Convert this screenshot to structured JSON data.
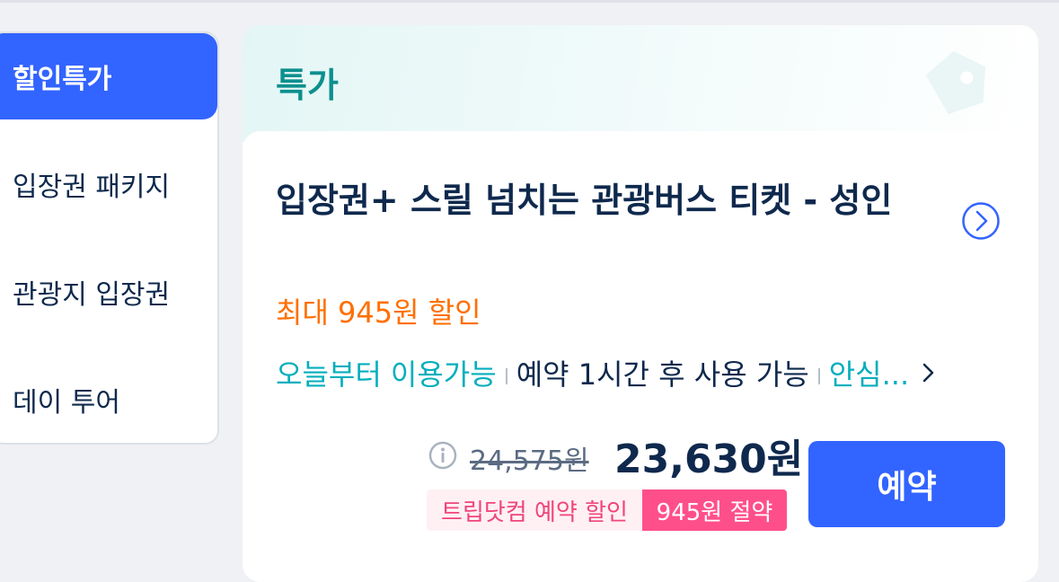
{
  "sidebar": {
    "items": [
      {
        "label": "할인특가",
        "active": true
      },
      {
        "label": "입장권 패키지",
        "active": false
      },
      {
        "label": "관광지 입장권",
        "active": false
      },
      {
        "label": "데이 투어",
        "active": false
      }
    ]
  },
  "section": {
    "title": "특가",
    "decoration_icon": "price-tag-icon"
  },
  "product": {
    "title": "입장권+ 스릴 넘치는 관광버스 티켓 - 성인",
    "detail_icon": "circle-chevron-right-icon",
    "discount_text": "최대 945원 할인",
    "info": {
      "available_from": "오늘부터 이용가능",
      "usable_after": "예약 1시간 후 사용 가능",
      "assurance": "안심...",
      "more_icon": "chevron-right-icon"
    },
    "price": {
      "info_icon": "info-circle-icon",
      "original": "24,575원",
      "sale": "23,630원"
    },
    "promo": {
      "label": "트립닷컴 예약 할인",
      "saving": "945원 절약"
    },
    "book_label": "예약"
  },
  "colors": {
    "primary": "#3264ff",
    "teal": "#0d8f8f",
    "discount_orange": "#ff6f00",
    "info_teal": "#06aebd",
    "promo_pink": "#ff4f8b",
    "text_dark": "#0f294d"
  }
}
